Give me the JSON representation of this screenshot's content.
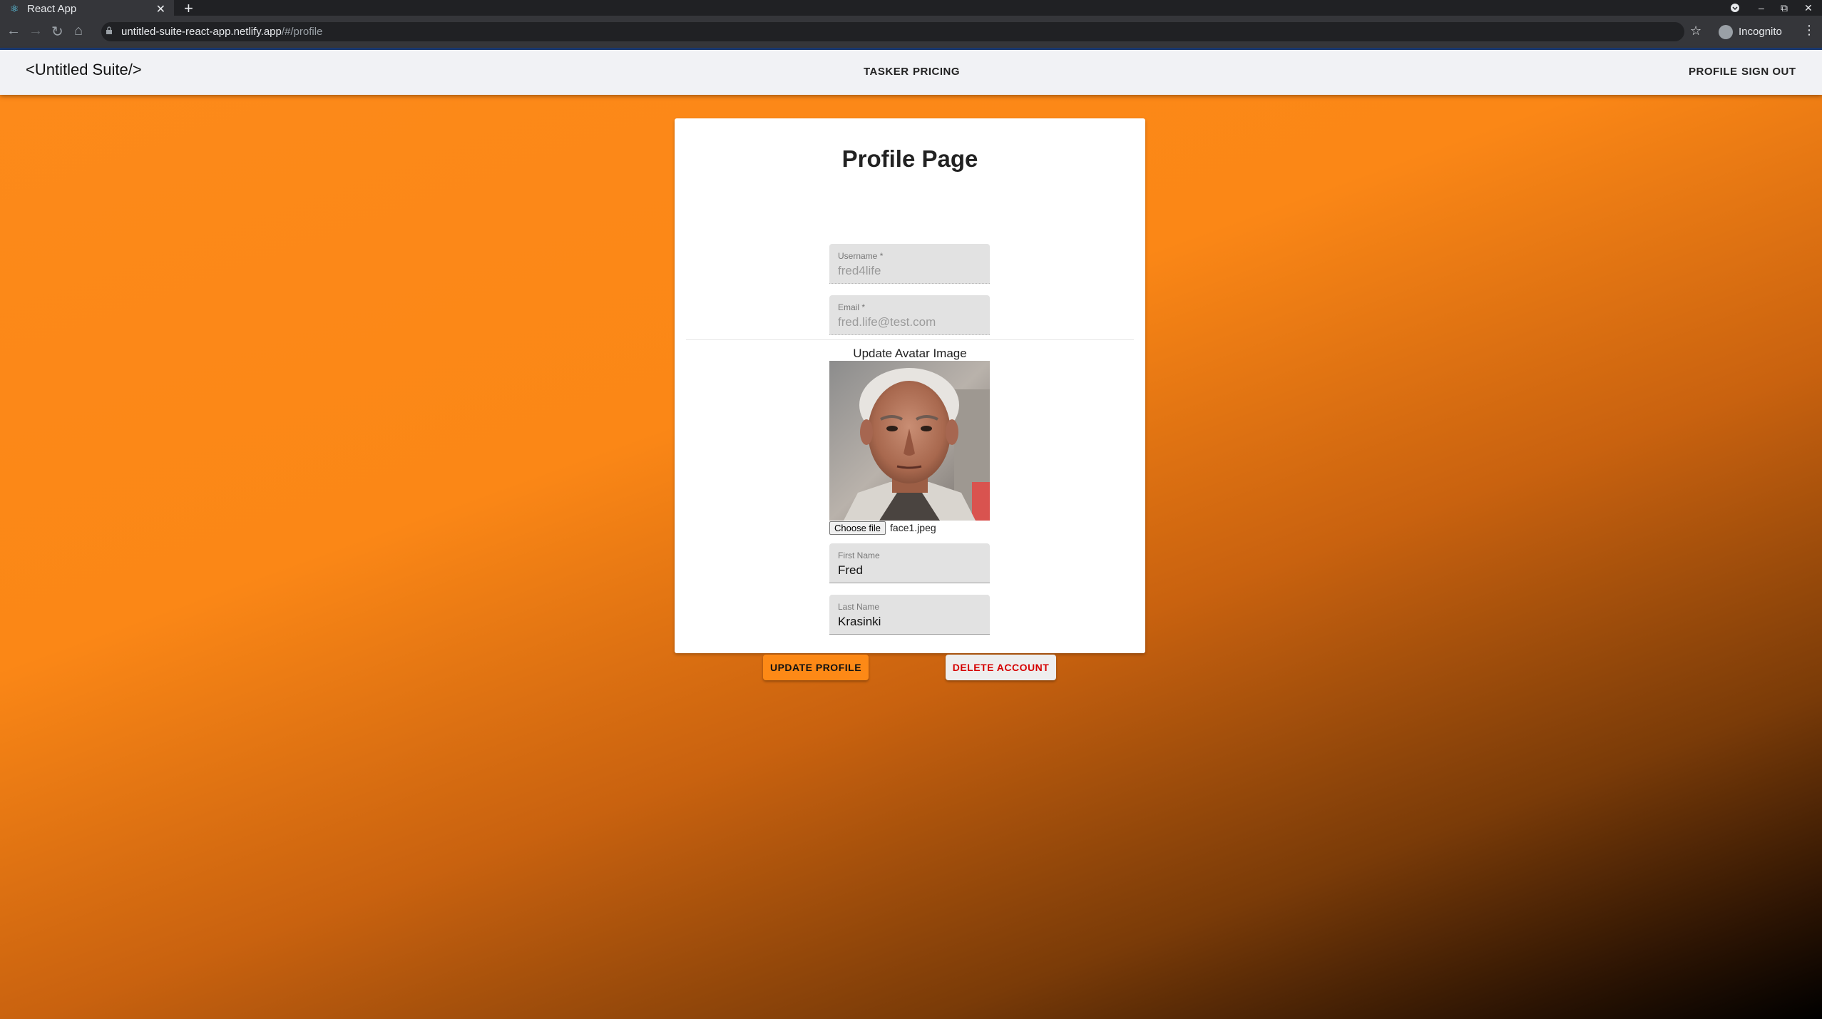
{
  "browser": {
    "tab_title": "React App",
    "new_tab_label": "+",
    "url_host": "untitled-suite-react-app.netlify.app",
    "url_path": "/#/profile",
    "incognito_label": "Incognito"
  },
  "appbar": {
    "brand": "<Untitled Suite/>",
    "nav_center": [
      "TASKER",
      "PRICING"
    ],
    "nav_right": [
      "PROFILE",
      "SIGN OUT"
    ]
  },
  "profile": {
    "title": "Profile Page",
    "username": {
      "label": "Username *",
      "value": "fred4life"
    },
    "email": {
      "label": "Email *",
      "value": "fred.life@test.com"
    },
    "avatar_label": "Update Avatar Image",
    "file_button": "Choose file",
    "file_name": "face1.jpeg",
    "first_name": {
      "label": "First Name",
      "value": "Fred"
    },
    "last_name": {
      "label": "Last Name",
      "value": "Krasinki"
    },
    "update_button": "UPDATE PROFILE",
    "delete_button": "DELETE ACCOUNT"
  },
  "icons": {
    "tab_favicon": "react-logo-icon",
    "back": "back-arrow-icon",
    "forward": "forward-arrow-icon",
    "reload": "reload-icon",
    "home": "home-icon",
    "lock": "lock-icon",
    "bookmark": "star-icon",
    "incognito": "incognito-icon",
    "menu": "kebab-menu-icon"
  },
  "colors": {
    "accent": "#fd8916",
    "delete_text": "#d50000",
    "appbar_bg": "#f1f2f5"
  }
}
